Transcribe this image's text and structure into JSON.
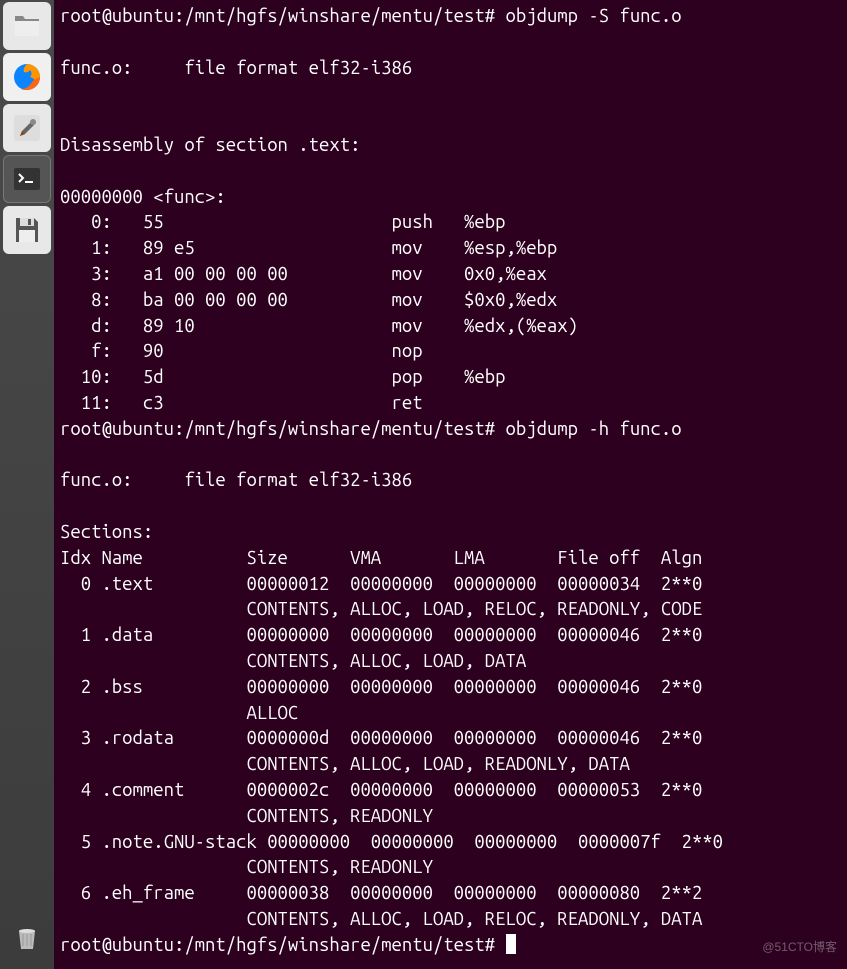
{
  "terminal": {
    "prompt": "root@ubuntu:/mnt/hgfs/winshare/mentu/test#",
    "cmd1": "objdump -S func.o",
    "cmd2": "objdump -h func.o",
    "file_header": "func.o:     file format elf32-i386",
    "disasm_header": "Disassembly of section .text:",
    "func_label": "00000000 <func>:",
    "disasm": [
      "   0:   55                      push   %ebp",
      "   1:   89 e5                   mov    %esp,%ebp",
      "   3:   a1 00 00 00 00          mov    0x0,%eax",
      "   8:   ba 00 00 00 00          mov    $0x0,%edx",
      "   d:   89 10                   mov    %edx,(%eax)",
      "   f:   90                      nop",
      "  10:   5d                      pop    %ebp",
      "  11:   c3                      ret    "
    ],
    "sections_label": "Sections:",
    "sections_header": "Idx Name          Size      VMA       LMA       File off  Algn",
    "sections": [
      "  0 .text         00000012  00000000  00000000  00000034  2**0",
      "                  CONTENTS, ALLOC, LOAD, RELOC, READONLY, CODE",
      "  1 .data         00000000  00000000  00000000  00000046  2**0",
      "                  CONTENTS, ALLOC, LOAD, DATA",
      "  2 .bss          00000000  00000000  00000000  00000046  2**0",
      "                  ALLOC",
      "  3 .rodata       0000000d  00000000  00000000  00000046  2**0",
      "                  CONTENTS, ALLOC, LOAD, READONLY, DATA",
      "  4 .comment      0000002c  00000000  00000000  00000053  2**0",
      "                  CONTENTS, READONLY",
      "  5 .note.GNU-stack 00000000  00000000  00000000  0000007f  2**0",
      "                  CONTENTS, READONLY",
      "  6 .eh_frame     00000038  00000000  00000000  00000080  2**2",
      "                  CONTENTS, ALLOC, LOAD, RELOC, READONLY, DATA"
    ]
  },
  "watermark": "@51CTO博客",
  "launcher": {
    "items": [
      "files",
      "firefox",
      "settings",
      "terminal",
      "save"
    ]
  }
}
